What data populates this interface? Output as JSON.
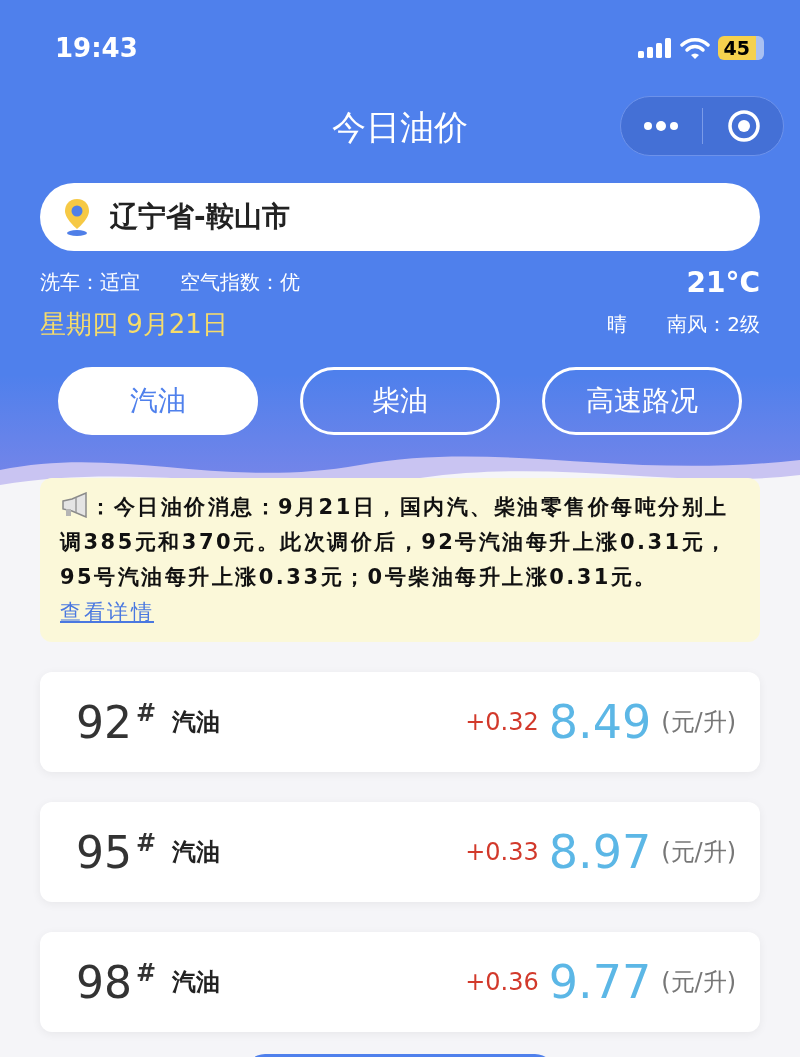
{
  "status_bar": {
    "time": "19:43",
    "battery": "45"
  },
  "header": {
    "title": "今日油价"
  },
  "location": {
    "value": "辽宁省-鞍山市"
  },
  "weather": {
    "car_wash": "洗车：适宜",
    "air_index": "空气指数：优",
    "temperature": "21°C",
    "date": "星期四 9月21日",
    "condition": "晴",
    "wind": "南风：2级"
  },
  "tabs": [
    {
      "label": "汽油",
      "selected": true
    },
    {
      "label": "柴油",
      "selected": false
    },
    {
      "label": "高速路况",
      "selected": false
    }
  ],
  "notice": {
    "text": "：今日油价消息：9月21日，国内汽、柴油零售价每吨分别上调385元和370元。此次调价后，92号汽油每升上涨0.31元，95号汽油每升上涨0.33元；0号柴油每升上涨0.31元。",
    "link": "查看详情"
  },
  "prices": [
    {
      "grade": "92",
      "mark": "#",
      "fuel": "汽油",
      "change": "+0.32",
      "price": "8.49",
      "unit": "(元/升)"
    },
    {
      "grade": "95",
      "mark": "#",
      "fuel": "汽油",
      "change": "+0.33",
      "price": "8.97",
      "unit": "(元/升)"
    },
    {
      "grade": "98",
      "mark": "#",
      "fuel": "汽油",
      "change": "+0.36",
      "price": "9.77",
      "unit": "(元/升)"
    }
  ]
}
